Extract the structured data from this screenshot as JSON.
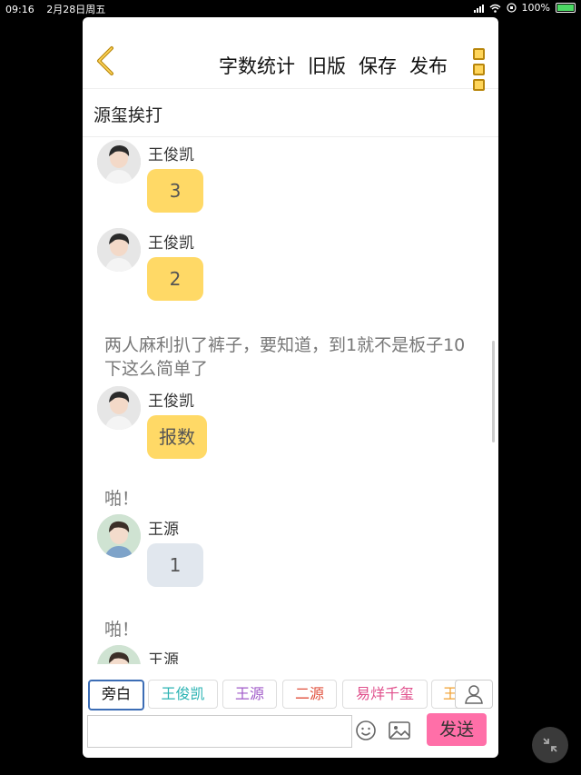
{
  "status": {
    "time": "09:16",
    "date": "2月28日周五",
    "battery": "100%"
  },
  "header": {
    "actions": [
      "字数统计",
      "旧版",
      "保存",
      "发布"
    ]
  },
  "chapter_title": "源玺挨打",
  "messages": [
    {
      "kind": "msg",
      "name": "王俊凯",
      "text": "3",
      "bubble": "yellow",
      "avatar": "wjk"
    },
    {
      "kind": "msg",
      "name": "王俊凯",
      "text": "2",
      "bubble": "yellow",
      "avatar": "wjk"
    },
    {
      "kind": "narr",
      "text": "两人麻利扒了裤子，要知道，到1就不是板子10下这么简单了"
    },
    {
      "kind": "msg",
      "name": "王俊凯",
      "text": "报数",
      "bubble": "yellow",
      "avatar": "wjk"
    },
    {
      "kind": "narr",
      "text": "啪！"
    },
    {
      "kind": "msg",
      "name": "王源",
      "text": "1",
      "bubble": "grey",
      "avatar": "wy"
    },
    {
      "kind": "narr",
      "text": "啪！"
    },
    {
      "kind": "msg",
      "name": "王源",
      "text": "",
      "bubble": "grey",
      "avatar": "wy"
    }
  ],
  "role_chips": [
    {
      "label": "旁白",
      "color": "#111111",
      "active": true
    },
    {
      "label": "王俊凯",
      "color": "#2bb3b3",
      "active": false
    },
    {
      "label": "王源",
      "color": "#a05ac8",
      "active": false
    },
    {
      "label": "二源",
      "color": "#e0503c",
      "active": false
    },
    {
      "label": "易烊千玺",
      "color": "#e0508c",
      "active": false
    },
    {
      "label": "王",
      "color": "#f0a030",
      "active": false
    }
  ],
  "composer": {
    "placeholder": "",
    "send_label": "发送"
  },
  "icons": {
    "back": "chevron-left-icon",
    "menu": "more-vertical-icon",
    "user": "user-icon",
    "emoji": "emoji-icon",
    "image": "image-icon",
    "collapse": "collapse-icon"
  },
  "colors": {
    "accent": "#ffd966",
    "send": "#ff6fa8",
    "menu": "#b8860b"
  }
}
